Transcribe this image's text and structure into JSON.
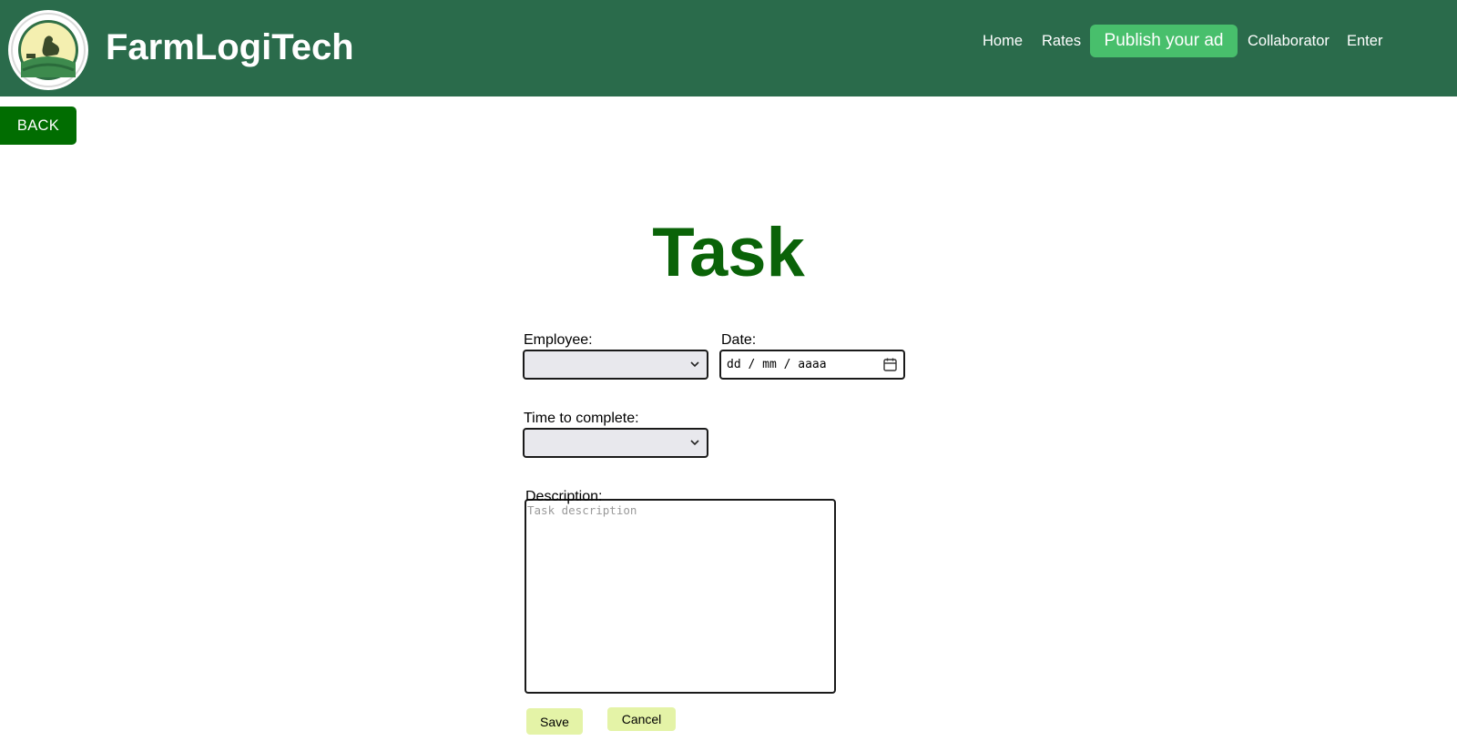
{
  "header": {
    "brand": "FarmLogiTech",
    "logo": "farm-hen-logo",
    "nav": {
      "home": "Home",
      "rates": "Rates",
      "publish": "Publish your ad",
      "collaborator": "Collaborator",
      "enter": "Enter"
    }
  },
  "back_button": "BACK",
  "page_title": "Task",
  "form": {
    "employee_label": "Employee:",
    "employee_value": "",
    "date_label": "Date:",
    "date_placeholder": "dd / mm / aaaa",
    "time_label": "Time to complete:",
    "time_value": "",
    "description_label": "Description:",
    "description_placeholder": "Task description",
    "save_label": "Save",
    "cancel_label": "Cancel"
  },
  "colors": {
    "header_bg": "#2a6b4b",
    "publish_bg": "#48bf6c",
    "back_bg": "#016d01",
    "title": "#0a6308",
    "form_buttons": "#e4f3a7"
  }
}
